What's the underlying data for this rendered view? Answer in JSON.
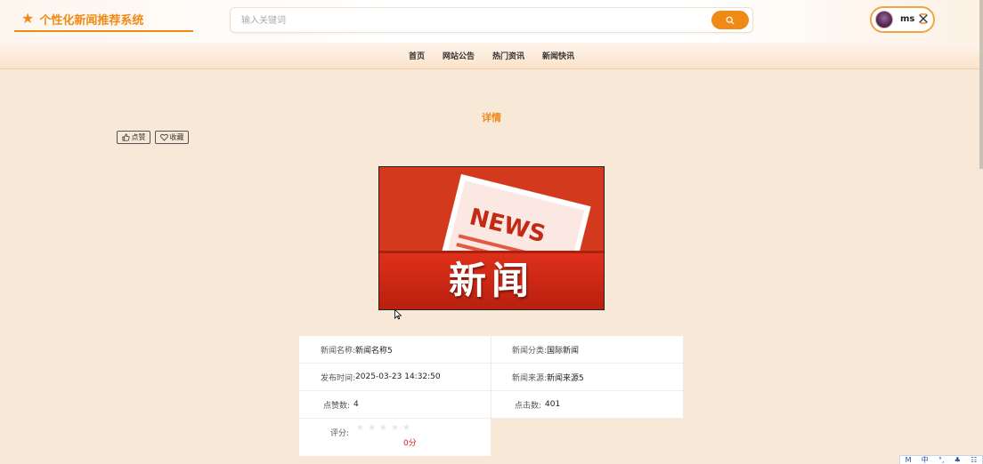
{
  "header": {
    "site_title": "个性化新闻推荐系统",
    "search": {
      "placeholder": "输入关键词",
      "value": ""
    },
    "user": {
      "name": "ms"
    }
  },
  "nav": {
    "items": [
      {
        "label": "首页"
      },
      {
        "label": "网站公告"
      },
      {
        "label": "热门资讯"
      },
      {
        "label": "新闻快讯"
      }
    ]
  },
  "main": {
    "page_title": "详情",
    "like_label": "点赞",
    "favorite_label": "收藏",
    "image_text": "新闻",
    "image_badge": "NEWS"
  },
  "details": {
    "name_label": "新闻名称:",
    "name_value": "新闻名称5",
    "category_label": "新闻分类:",
    "category_value": "国际新闻",
    "publish_label": "发布时间:",
    "publish_value": "2025-03-23 14:32:50",
    "source_label": "新闻来源:",
    "source_value": "新闻来源5",
    "likes_label": "点赞数:",
    "likes_value": "4",
    "clicks_label": "点击数:",
    "clicks_value": "401",
    "rating_label": "评分:",
    "rating_score": "0分",
    "rating_stars": 0,
    "rating_max": 5
  },
  "ime": {
    "items": [
      "M",
      "中",
      "°,",
      "♣",
      "☷"
    ]
  },
  "colors": {
    "accent": "#f08a17",
    "background": "#f7e8d8",
    "score": "#d0211f",
    "banner": "#d63b1e"
  }
}
